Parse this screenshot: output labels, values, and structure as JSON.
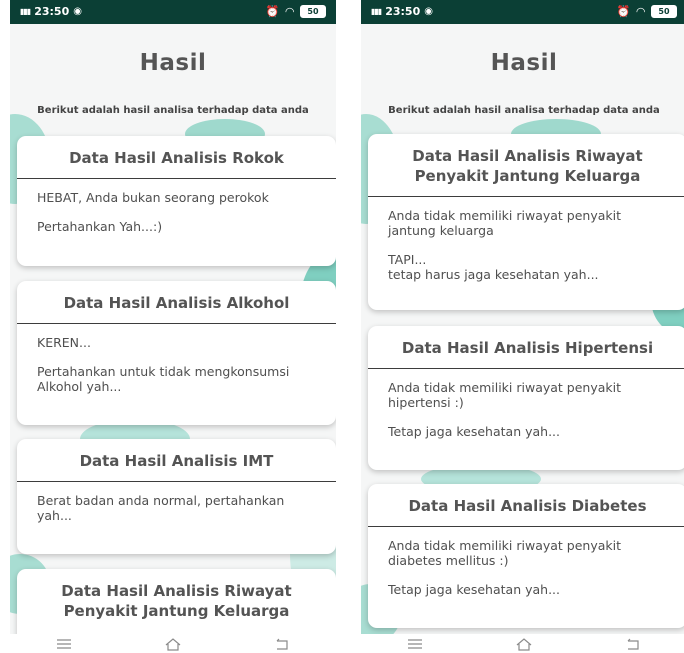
{
  "colors": {
    "status_bar": "#0b3f35",
    "accent_teal": "#7fcfc0"
  },
  "status_bar": {
    "time": "23:50",
    "signal_text": "4G",
    "battery": "50"
  },
  "left_screen": {
    "title": "Hasil",
    "subtitle": "Berikut adalah hasil analisa terhadap data anda",
    "cards": [
      {
        "title": "Data Hasil Analisis Rokok",
        "lines": [
          "HEBAT, Anda bukan seorang perokok",
          "Pertahankan Yah...:)"
        ]
      },
      {
        "title": "Data Hasil Analisis Alkohol",
        "lines": [
          "KEREN...",
          "Pertahankan untuk tidak mengkonsumsi\nAlkohol yah..."
        ]
      },
      {
        "title": "Data Hasil Analisis IMT",
        "lines": [
          "Berat badan anda normal, pertahankan\nyah..."
        ]
      },
      {
        "title": "Data Hasil Analisis Riwayat\nPenyakit Jantung Keluarga",
        "lines": []
      }
    ]
  },
  "right_screen": {
    "title": "Hasil",
    "subtitle": "Berikut adalah hasil analisa terhadap data anda",
    "cards": [
      {
        "title": "Data Hasil Analisis Riwayat\nPenyakit Jantung Keluarga",
        "lines": [
          "Anda tidak memiliki riwayat penyakit\njantung keluarga",
          "TAPI...\ntetap harus jaga kesehatan yah..."
        ]
      },
      {
        "title": "Data Hasil Analisis Hipertensi",
        "lines": [
          "Anda tidak memiliki riwayat penyakit\nhipertensi :)",
          "Tetap jaga kesehatan yah..."
        ]
      },
      {
        "title": "Data Hasil Analisis Diabetes",
        "lines": [
          "Anda tidak memiliki riwayat penyakit\ndiabetes mellitus :)",
          "Tetap jaga kesehatan yah..."
        ]
      }
    ]
  },
  "nav_icons": [
    "menu-icon",
    "home-icon",
    "back-icon"
  ]
}
